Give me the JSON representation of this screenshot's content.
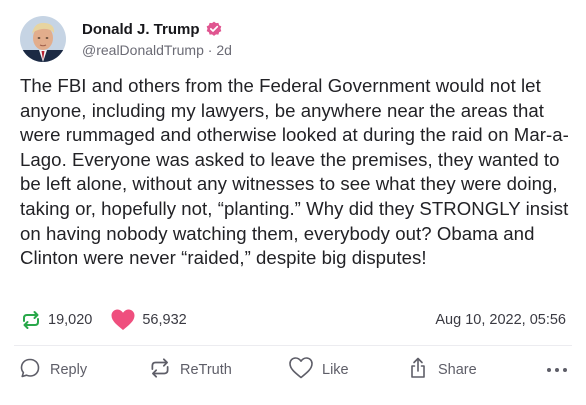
{
  "author": {
    "display_name": "Donald J. Trump",
    "handle": "@realDonaldTrump",
    "age": "2d",
    "verified_color": "#e05590"
  },
  "post": {
    "text": "The FBI and others from the Federal Government would not let anyone, including my lawyers, be anywhere near the areas that were rummaged and otherwise looked at during the raid on Mar-a-Lago. Everyone was asked to leave the premises, they wanted to be left alone, without any witnesses to see what they were doing, taking or, hopefully not, “planting.” Why did they STRONGLY insist on having nobody watching them, everybody out? Obama and Clinton were never “raided,” despite big disputes!"
  },
  "stats": {
    "retruths": "19,020",
    "likes": "56,932",
    "timestamp": "Aug 10, 2022, 05:56",
    "retruth_color": "#29a84a",
    "like_color": "#ef4f7e"
  },
  "actions": {
    "reply": "Reply",
    "retruth": "ReTruth",
    "like": "Like",
    "share": "Share"
  }
}
